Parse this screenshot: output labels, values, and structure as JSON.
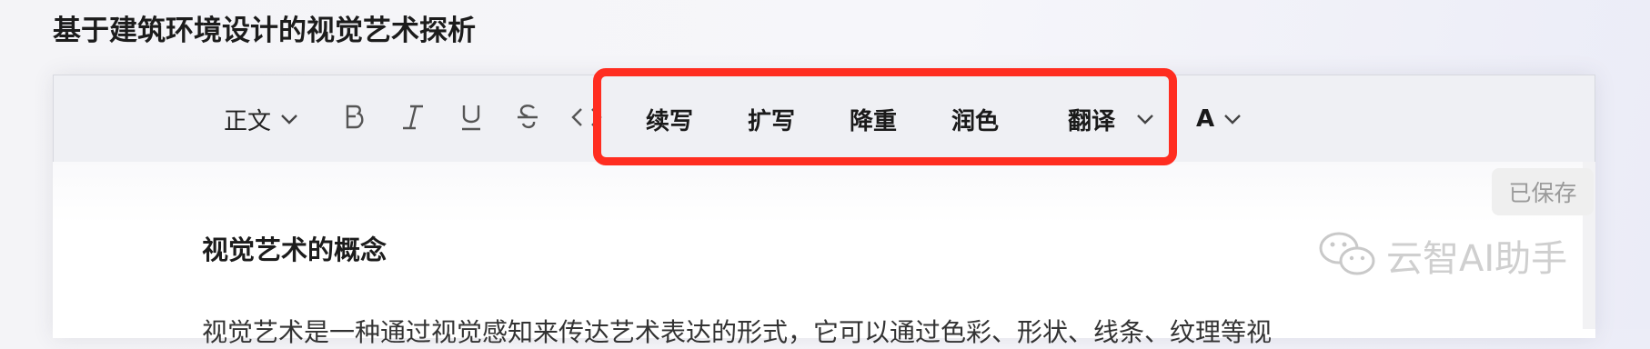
{
  "document": {
    "title": "基于建筑环境设计的视觉艺术探析"
  },
  "toolbar": {
    "paragraph_style": "正文",
    "bold_icon": "bold-icon",
    "italic_icon": "italic-icon",
    "underline_icon": "underline-icon",
    "strikethrough_icon": "strikethrough-icon",
    "code_icon": "code-icon",
    "ai_actions": [
      "续写",
      "扩写",
      "降重",
      "润色",
      "翻译"
    ],
    "font_label": "A",
    "highlight_color": "#ff2d20"
  },
  "status": {
    "saved": "已保存"
  },
  "content": {
    "heading": "视觉艺术的概念",
    "paragraph_start": "视觉艺术是一种通过视觉感知来传达艺术表达的形式，它可以通过色彩、形状、线条、纹理等视"
  },
  "watermark": {
    "text": "云智AI助手",
    "icon": "wechat-icon"
  }
}
